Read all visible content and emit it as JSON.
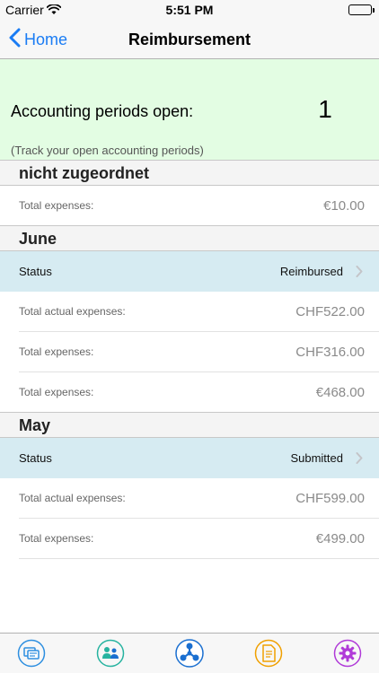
{
  "status_bar": {
    "carrier": "Carrier",
    "time": "5:51 PM"
  },
  "nav": {
    "back_label": "Home",
    "title": "Reimbursement"
  },
  "summary": {
    "label": "Accounting periods open:",
    "value": "1",
    "hint": "(Track your open accounting periods)"
  },
  "sections": [
    {
      "title": "nicht zugeordnet",
      "rows": [
        {
          "label": "Total expenses:",
          "value": "€10.00"
        }
      ]
    },
    {
      "title": "June",
      "status": {
        "label": "Status",
        "value": "Reimbursed"
      },
      "rows": [
        {
          "label": "Total actual expenses:",
          "value": "CHF522.00"
        },
        {
          "label": "Total expenses:",
          "value": "CHF316.00"
        },
        {
          "label": "Total expenses:",
          "value": "€468.00"
        }
      ]
    },
    {
      "title": "May",
      "status": {
        "label": "Status",
        "value": "Submitted"
      },
      "rows": [
        {
          "label": "Total actual expenses:",
          "value": "CHF599.00"
        },
        {
          "label": "Total expenses:",
          "value": "€499.00"
        }
      ]
    }
  ],
  "tabs": [
    {
      "icon": "receipts-icon",
      "color": "#2e8fe0"
    },
    {
      "icon": "people-icon",
      "color": "#27b3a0"
    },
    {
      "icon": "share-icon",
      "color": "#1a6fd0"
    },
    {
      "icon": "document-icon",
      "color": "#f0a000"
    },
    {
      "icon": "gear-icon",
      "color": "#b03ad8"
    }
  ],
  "colors": {
    "accent": "#1a7cf4",
    "summary_bg": "#e3fde3",
    "status_row_bg": "#d6ebf2"
  }
}
